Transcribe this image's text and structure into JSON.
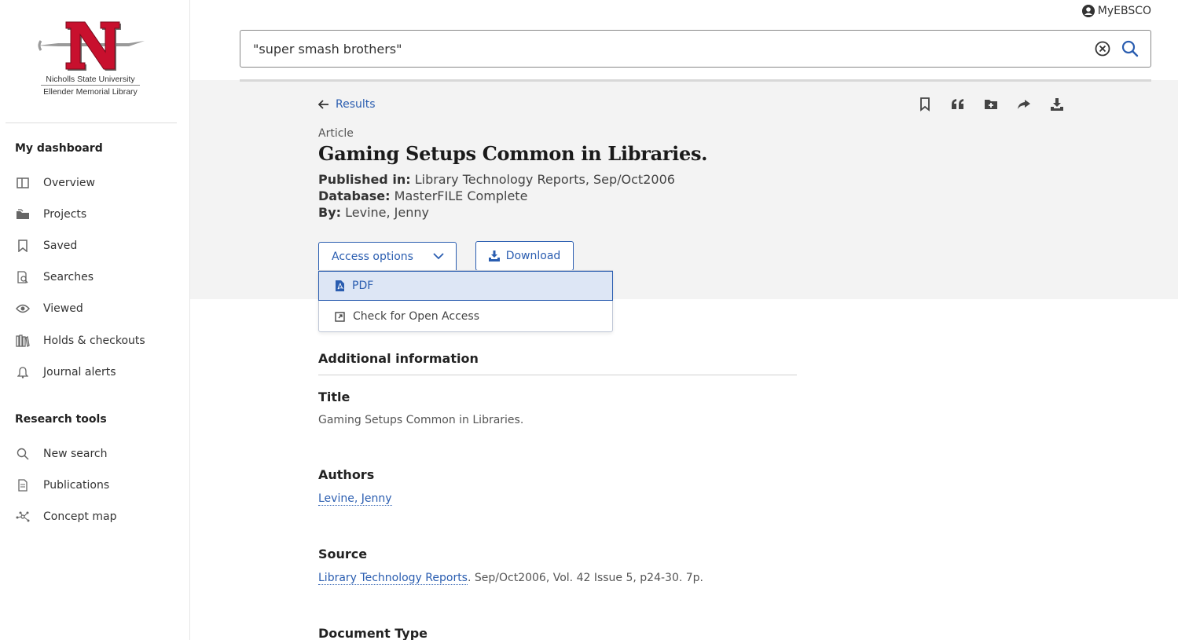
{
  "sidebar": {
    "logo": {
      "university": "Nicholls State University",
      "library": "Ellender Memorial Library",
      "brand_color": "#c8102e"
    },
    "dashboard_heading": "My dashboard",
    "dashboard_items": [
      {
        "label": "Overview",
        "icon": "overview-icon"
      },
      {
        "label": "Projects",
        "icon": "folder-icon"
      },
      {
        "label": "Saved",
        "icon": "bookmark-icon"
      },
      {
        "label": "Searches",
        "icon": "search-history-icon"
      },
      {
        "label": "Viewed",
        "icon": "eye-icon"
      },
      {
        "label": "Holds & checkouts",
        "icon": "books-icon"
      },
      {
        "label": "Journal alerts",
        "icon": "bell-icon"
      }
    ],
    "tools_heading": "Research tools",
    "tools_items": [
      {
        "label": "New search",
        "icon": "search-icon"
      },
      {
        "label": "Publications",
        "icon": "document-icon"
      },
      {
        "label": "Concept map",
        "icon": "concept-map-icon"
      }
    ]
  },
  "header": {
    "account_label": "MyEBSCO",
    "search_value": "\"super smash brothers\""
  },
  "article": {
    "back_label": "Results",
    "type": "Article",
    "title": "Gaming Setups Common in Libraries.",
    "published_label": "Published in:",
    "published_value": "Library Technology Reports, Sep/Oct2006",
    "database_label": "Database:",
    "database_value": "MasterFILE Complete",
    "by_label": "By:",
    "by_value": "Levine, Jenny",
    "access_button": "Access options",
    "download_button": "Download",
    "access_menu": [
      {
        "label": "PDF",
        "icon": "pdf-icon"
      },
      {
        "label": "Check for Open Access",
        "icon": "external-link-icon"
      }
    ]
  },
  "additional": {
    "heading": "Additional information",
    "title_label": "Title",
    "title_value": "Gaming Setups Common in Libraries.",
    "authors_label": "Authors",
    "authors_value": "Levine, Jenny",
    "source_label": "Source",
    "source_link": "Library Technology Reports",
    "source_rest": ". Sep/Oct2006, Vol. 42 Issue 5, p24-30. 7p.",
    "doctype_label": "Document Type"
  },
  "colors": {
    "accent": "#2a5db0",
    "band": "#f3f3f3",
    "selected_bg": "#dde6f5"
  }
}
